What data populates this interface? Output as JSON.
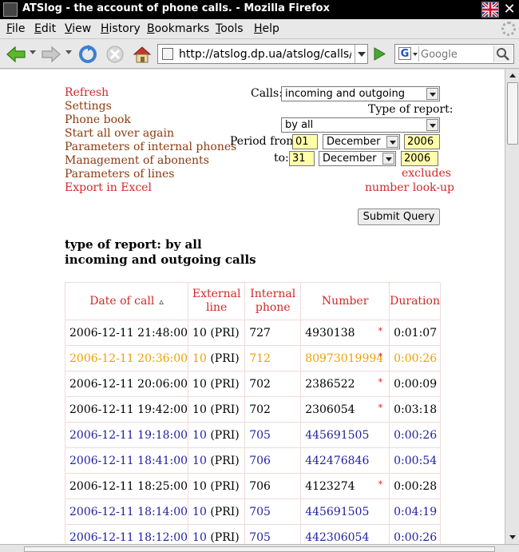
{
  "window": {
    "title": "ATSlog - the account of phone calls. - Mozilla Firefox"
  },
  "menu": [
    {
      "label": "File",
      "acc": "F",
      "rest": "ile"
    },
    {
      "label": "Edit",
      "acc": "E",
      "rest": "dit"
    },
    {
      "label": "View",
      "acc": "V",
      "rest": "iew"
    },
    {
      "label": "History",
      "acc": "H",
      "rest": "istory"
    },
    {
      "label": "Bookmarks",
      "acc": "B",
      "rest": "ookmarks"
    },
    {
      "label": "Tools",
      "acc": "T",
      "rest": "ools"
    },
    {
      "label": "Help",
      "acc": "H",
      "rest": "elp"
    }
  ],
  "nav": {
    "url": "http://atslog.dp.ua/atslog/calls/ir",
    "search_placeholder": "Google"
  },
  "links": [
    {
      "label": "Refresh",
      "red": true
    },
    {
      "label": "Settings",
      "red": false
    },
    {
      "label": "Phone book",
      "red": false
    },
    {
      "label": "Start all over again",
      "red": false
    },
    {
      "label": "Parameters of internal phones",
      "red": false
    },
    {
      "label": "Management of abonents",
      "red": false
    },
    {
      "label": "Parameters of lines",
      "red": false
    },
    {
      "label": "Export in Excel",
      "red": true
    }
  ],
  "form": {
    "calls_label": "Calls:",
    "calls_value": "incoming and outgoing",
    "report_type_label": "Type of report:",
    "report_type_value": "by all",
    "period_from_label": "Period from:",
    "from_day": "01",
    "from_month": "December",
    "from_year": "2006",
    "to_label": "to:",
    "to_day": "31",
    "to_month": "December",
    "to_year": "2006",
    "excludes_link": "excludes",
    "lookup_link": "number look-up",
    "submit_label": "Submit Query"
  },
  "report": {
    "title_line1": "type of report: by all",
    "title_line2": "incoming and outgoing calls"
  },
  "table": {
    "headers": {
      "date": "Date of call",
      "external_line1": "External",
      "external_line2": "line",
      "internal_line1": "Internal",
      "internal_line2": "phone",
      "number": "Number",
      "duration": "Duration"
    },
    "rows": [
      {
        "date": "2006-12-11 21:48:00",
        "line": "10",
        "pri": " (PRI)",
        "internal": "727",
        "number": "4930138",
        "star": "*",
        "duration": "0:01:07",
        "color": "black"
      },
      {
        "date": "2006-12-11 20:36:00",
        "line": "10",
        "pri": " (PRI)",
        "internal": "712",
        "number": "80973019994",
        "star": "*",
        "duration": "0:00:26",
        "color": "orange"
      },
      {
        "date": "2006-12-11 20:06:00",
        "line": "10",
        "pri": " (PRI)",
        "internal": "702",
        "number": "2386522",
        "star": "*",
        "duration": "0:00:09",
        "color": "black"
      },
      {
        "date": "2006-12-11 19:42:00",
        "line": "10",
        "pri": " (PRI)",
        "internal": "702",
        "number": "2306054",
        "star": "*",
        "duration": "0:03:18",
        "color": "black"
      },
      {
        "date": "2006-12-11 19:18:00",
        "line": "10",
        "pri": " (PRI)",
        "internal": "705",
        "number": "445691505",
        "star": "",
        "duration": "0:00:26",
        "color": "blue"
      },
      {
        "date": "2006-12-11 18:41:00",
        "line": "10",
        "pri": " (PRI)",
        "internal": "706",
        "number": "442476846",
        "star": "",
        "duration": "0:00:54",
        "color": "blue"
      },
      {
        "date": "2006-12-11 18:25:00",
        "line": "10",
        "pri": " (PRI)",
        "internal": "706",
        "number": "4123274",
        "star": "*",
        "duration": "0:00:28",
        "color": "black"
      },
      {
        "date": "2006-12-11 18:14:00",
        "line": "10",
        "pri": " (PRI)",
        "internal": "705",
        "number": "445691505",
        "star": "",
        "duration": "0:04:19",
        "color": "blue"
      },
      {
        "date": "2006-12-11 18:12:00",
        "line": "10",
        "pri": " (PRI)",
        "internal": "705",
        "number": "442306054",
        "star": "",
        "duration": "0:00:26",
        "color": "blue"
      }
    ]
  }
}
